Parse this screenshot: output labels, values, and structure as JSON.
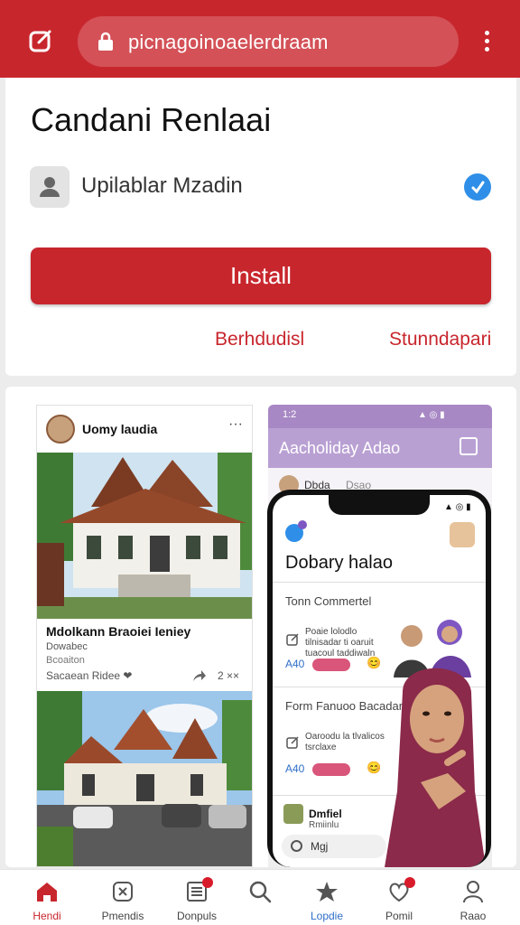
{
  "colors": {
    "brand": "#c8262d",
    "verified": "#2f8fe8",
    "chat_header": "#b9a0d3",
    "pill": "#d9557a"
  },
  "browser": {
    "url": "picnagoinoaelerdraam",
    "edit_icon": "edit-icon",
    "lock_icon": "lock-icon",
    "menu_icon": "more-vert-icon"
  },
  "app": {
    "title": "Candani Renlaai",
    "developer": "Upilablar Mzadin",
    "install_label": "Install",
    "link_left": "Berhdudisl",
    "link_right": "Stunndapari"
  },
  "screenshots": {
    "post": {
      "user": "Uomy laudia",
      "more": "···",
      "caption": "Mdolkann Braoiei Ieniey",
      "sub1": "Dowabec",
      "sub2": "Bcoaiton",
      "reactions": "Sacaean Ridee ❤",
      "count": "2 ××"
    },
    "chat": {
      "time": "1:2",
      "status_icons": "▲ ◎ ▮",
      "title": "Aacholiday Adao",
      "row_name": "Dbda",
      "row_sub": "Dsao"
    },
    "phone": {
      "status": "▲ ◎ ▮",
      "title": "Dobary halao",
      "section1_title": "Tonn Commertel",
      "section1_text": "Poaie lolodlo tilnisadar ti oaruit tuacoul taddiwaln",
      "section1_num": "A40",
      "section2_title": "Form Fanuoo Bacadan",
      "section2_text": "Oaroodu la tlvalicos tsrclaxe",
      "section2_num": "A40",
      "bottom_name": "Dmfiel",
      "bottom_sub": "Rmiinlu",
      "search_text": "Mgj"
    }
  },
  "nav": [
    {
      "label": "Hendi",
      "icon": "home-icon",
      "active": true
    },
    {
      "label": "Pmendis",
      "icon": "apps-icon"
    },
    {
      "label": "Donpuls",
      "icon": "list-icon",
      "badge": true
    },
    {
      "label": "",
      "icon": "search-icon"
    },
    {
      "label": "Lopdie",
      "icon": "star-icon"
    },
    {
      "label": "Pomil",
      "icon": "heart-icon",
      "badge": true
    },
    {
      "label": "Raao",
      "icon": "person-icon"
    }
  ]
}
